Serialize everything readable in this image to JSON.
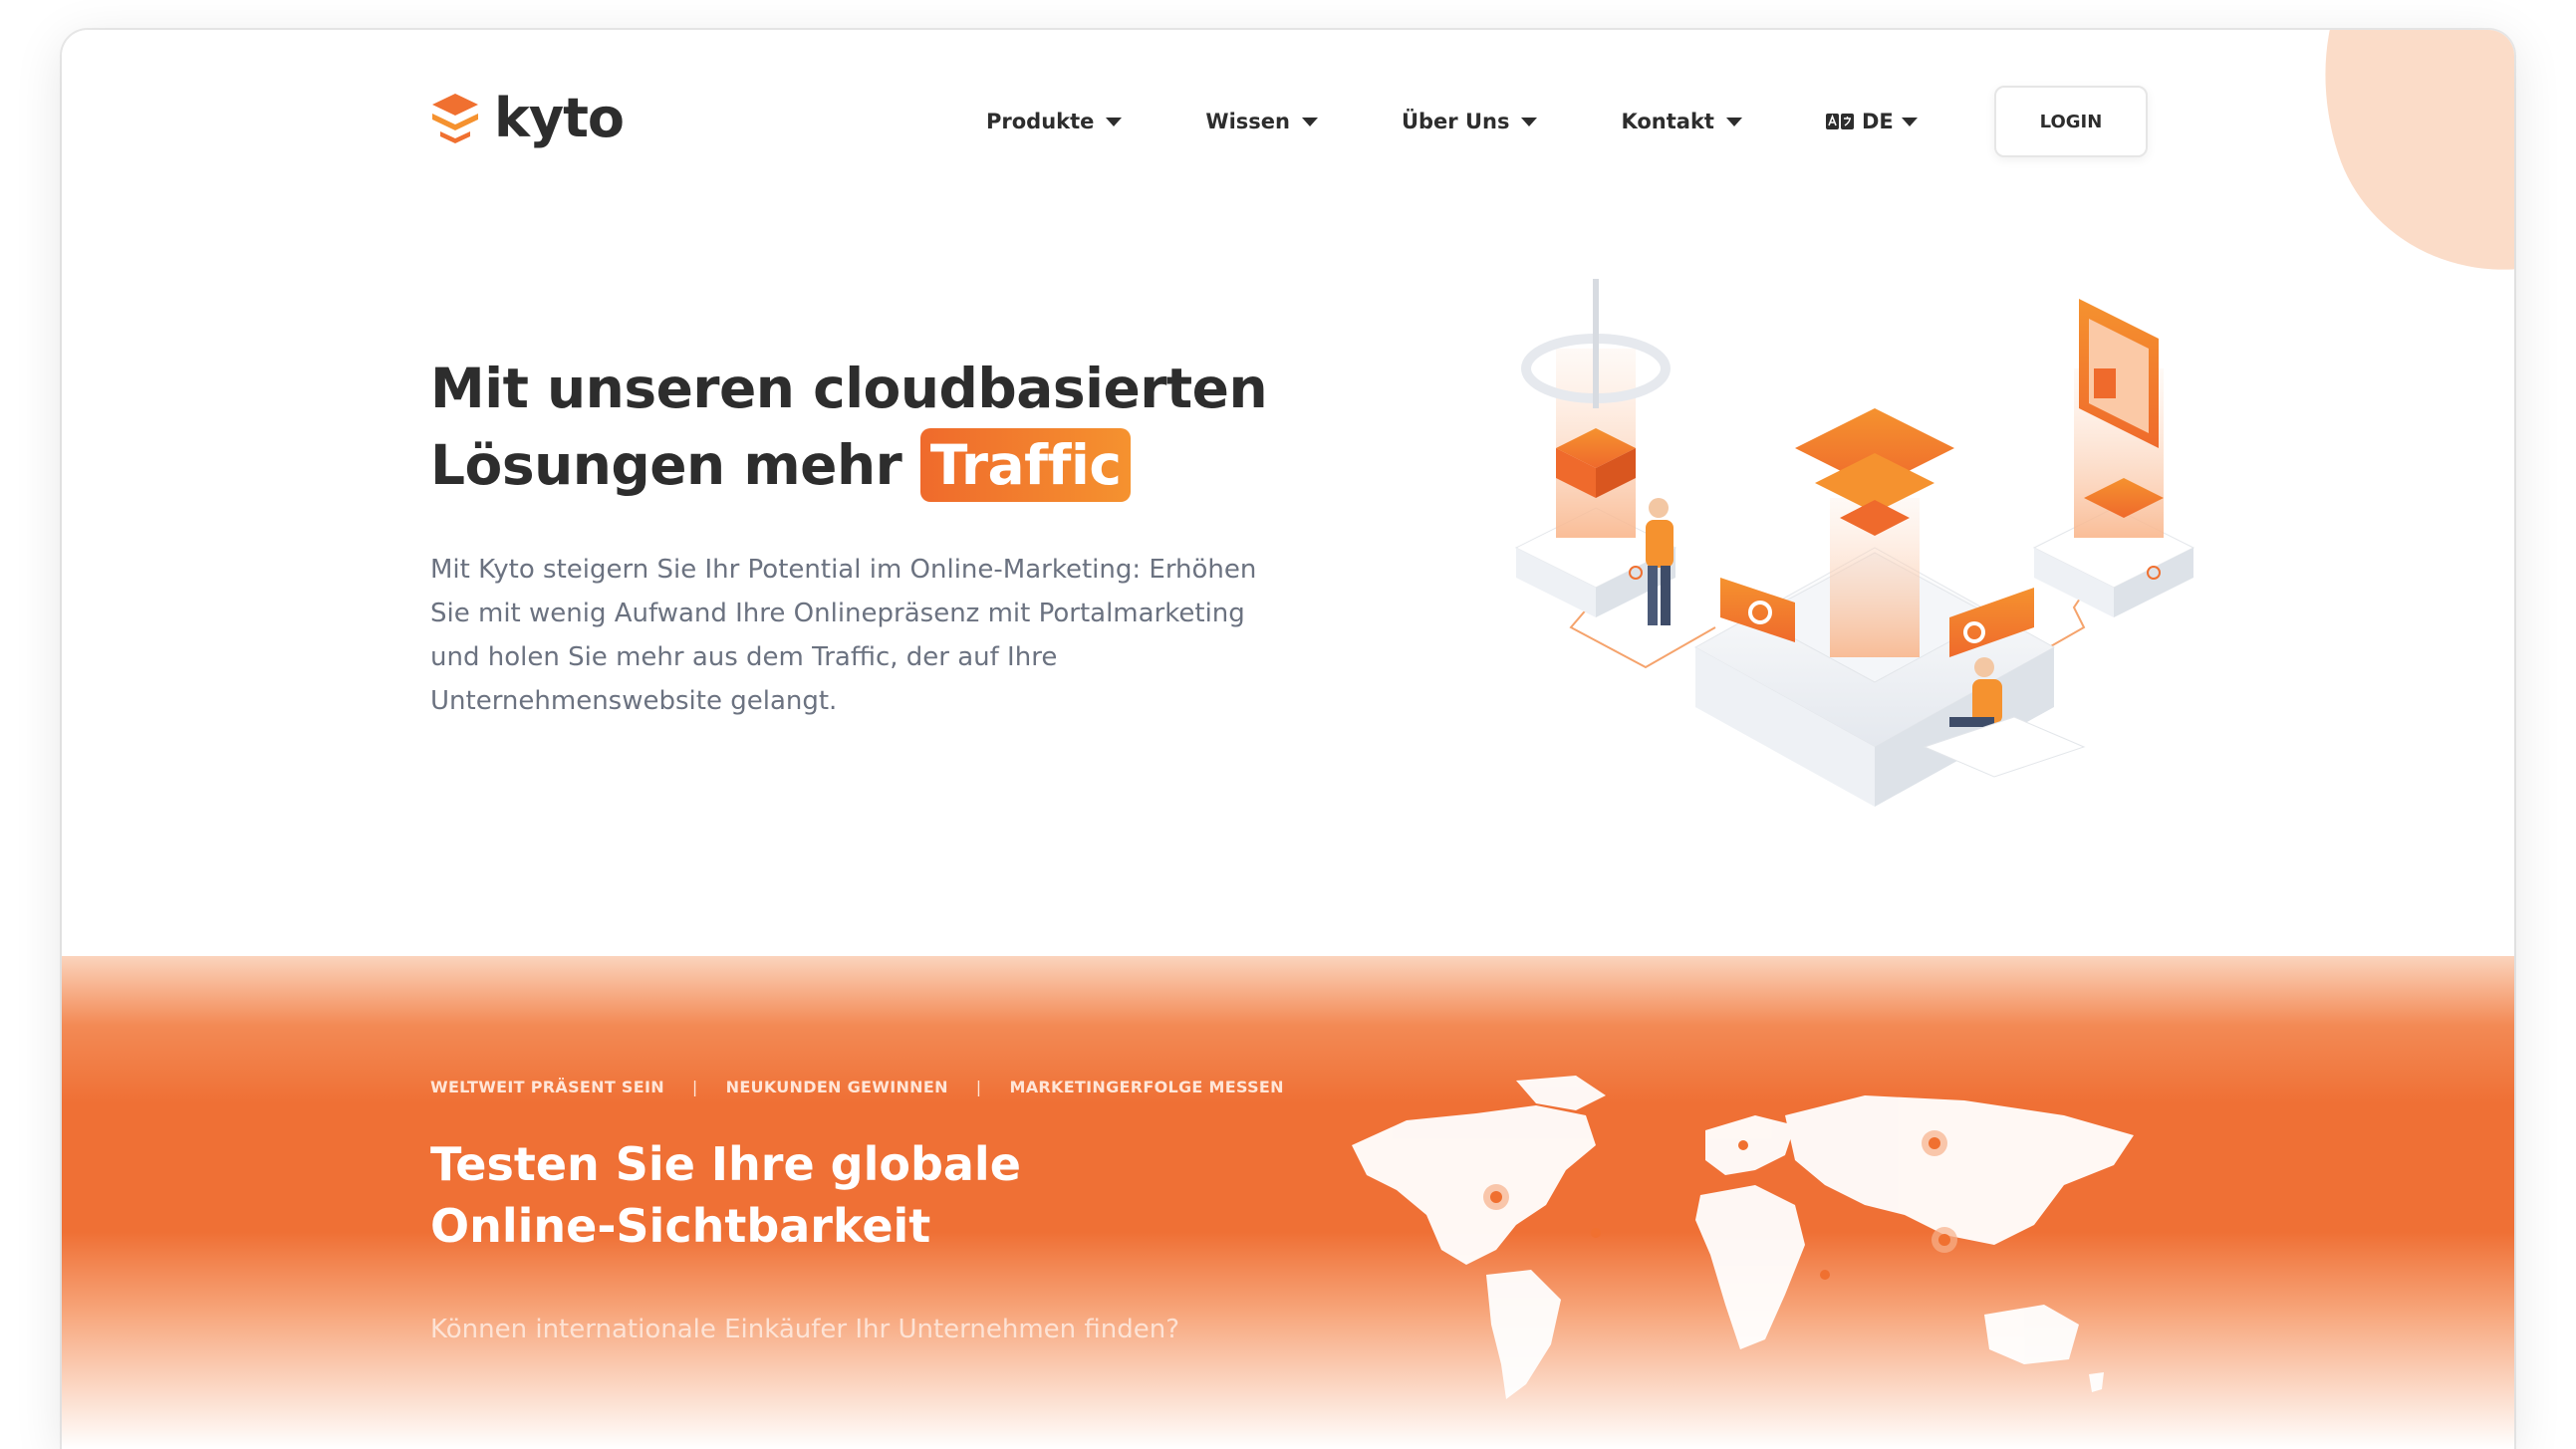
{
  "brand": {
    "name": "kyto",
    "accent": "#f07030",
    "accent_light": "#f5922f",
    "text_dark": "#2d2d2d"
  },
  "nav": {
    "items": [
      {
        "label": "Produkte"
      },
      {
        "label": "Wissen"
      },
      {
        "label": "Über Uns"
      },
      {
        "label": "Kontakt"
      }
    ],
    "language": {
      "label": "DE",
      "icon": "language-icon"
    },
    "login_label": "LOGIN"
  },
  "hero": {
    "title_line1": "Mit unseren cloudbasierten",
    "title_line2": "Lösungen mehr",
    "title_highlight": "Traffic",
    "text": "Mit Kyto steigern Sie Ihr Potential im Online-Marketing: Erhöhen Sie mit wenig Aufwand Ihre Onlinepräsenz mit Portalmarketing und holen Sie mehr aus dem Traffic, der auf Ihre Unternehmenswebsite gelangt."
  },
  "section": {
    "tags": [
      "WELTWEIT PRÄSENT SEIN",
      "NEUKUNDEN GEWINNEN",
      "MARKETINGERFOLGE MESSEN"
    ],
    "title": "Testen Sie Ihre globale Online-Sichtbarkeit",
    "subtitle": "Können internationale Einkäufer Ihr Unternehmen finden?"
  }
}
